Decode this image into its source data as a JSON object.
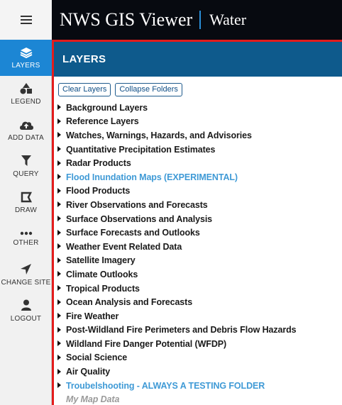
{
  "header": {
    "title": "NWS GIS Viewer",
    "subtitle": "Water"
  },
  "sidebar": {
    "items": [
      {
        "label": "LAYERS",
        "icon": "layers-icon",
        "active": true
      },
      {
        "label": "LEGEND",
        "icon": "legend-icon"
      },
      {
        "label": "ADD DATA",
        "icon": "cloud-upload-icon"
      },
      {
        "label": "QUERY",
        "icon": "filter-icon"
      },
      {
        "label": "DRAW",
        "icon": "draw-icon"
      },
      {
        "label": "OTHER",
        "icon": "more-dots-icon"
      },
      {
        "label": "CHANGE SITE",
        "icon": "location-arrow-icon"
      },
      {
        "label": "LOGOUT",
        "icon": "user-icon"
      }
    ]
  },
  "panel": {
    "title": "LAYERS",
    "clear_label": "Clear Layers",
    "collapse_label": "Collapse Folders",
    "layers": [
      {
        "label": "Background Layers"
      },
      {
        "label": "Reference Layers"
      },
      {
        "label": "Watches, Warnings, Hazards, and Advisories"
      },
      {
        "label": "Quantitative Precipitation Estimates"
      },
      {
        "label": "Radar Products"
      },
      {
        "label": "Flood Inundation Maps (EXPERIMENTAL)",
        "style": "experimental"
      },
      {
        "label": "Flood Products"
      },
      {
        "label": "River Observations and Forecasts"
      },
      {
        "label": "Surface Observations and Analysis"
      },
      {
        "label": "Surface Forecasts and Outlooks"
      },
      {
        "label": "Weather Event Related Data"
      },
      {
        "label": "Satellite Imagery"
      },
      {
        "label": "Climate Outlooks"
      },
      {
        "label": "Tropical Products"
      },
      {
        "label": "Ocean Analysis and Forecasts"
      },
      {
        "label": "Fire Weather"
      },
      {
        "label": "Post-Wildland Fire Perimeters and Debris Flow Hazards"
      },
      {
        "label": "Wildland Fire Danger Potential (WFDP)"
      },
      {
        "label": "Social Science"
      },
      {
        "label": "Air Quality"
      },
      {
        "label": "Troubelshooting - ALWAYS A TESTING FOLDER",
        "style": "experimental"
      },
      {
        "label": "My Map Data",
        "style": "mymap"
      }
    ]
  },
  "colors": {
    "header_bg": "#070a10",
    "panel_header_bg": "#0e5a8c",
    "active_nav": "#1c86d4",
    "highlight_border": "#e31c1c",
    "link_blue": "#3f9ad6"
  }
}
